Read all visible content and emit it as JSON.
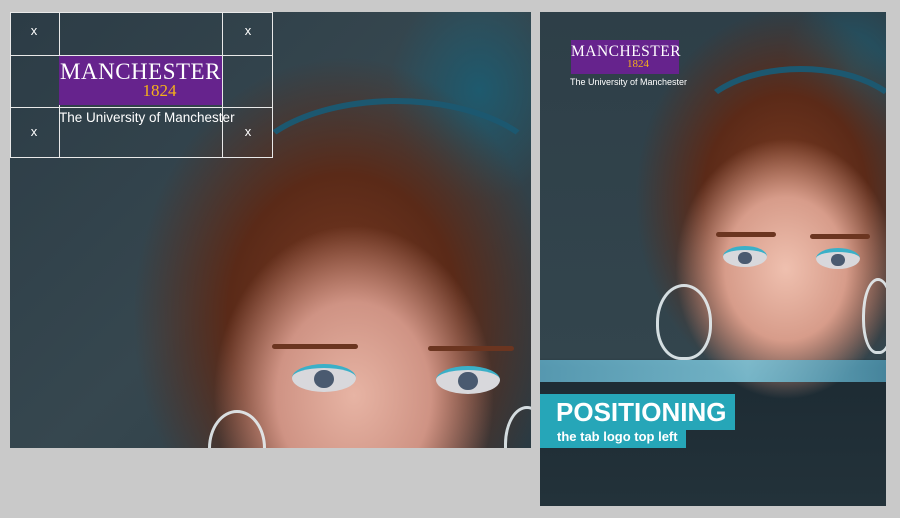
{
  "left_panel": {
    "logo": {
      "wordmark": "MANCHESTER",
      "year": "1824",
      "tagline": "The University of Manchester"
    },
    "exclusion_marks": [
      "x",
      "x",
      "x",
      "x"
    ]
  },
  "right_panel": {
    "logo": {
      "wordmark": "MANCHESTER",
      "year": "1824",
      "tagline": "The University of Manchester"
    },
    "title": "POSITIONING",
    "subtitle": "the tab logo top left"
  },
  "colors": {
    "brand_purple": "#66238d",
    "brand_gold": "#f6b21a",
    "accent_teal": "#26a6b8",
    "page_background": "#c9c9c9"
  }
}
